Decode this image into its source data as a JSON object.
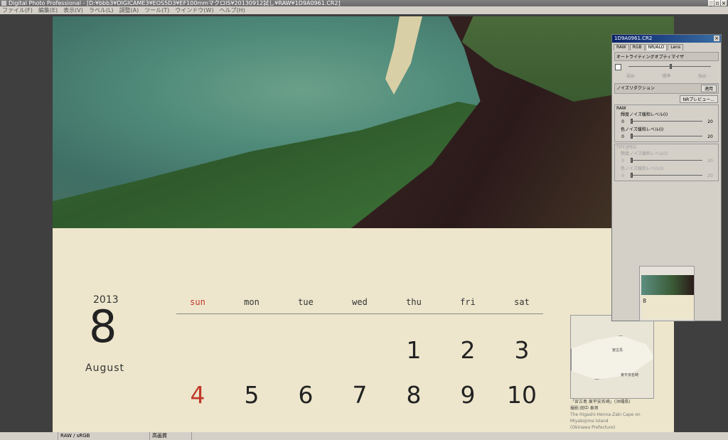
{
  "window": {
    "title": "Digital Photo Professional - [D:¥bbb3¥DIGICAME3¥EOS5D3¥EF100mmマクロIS¥20130912試し¥RAW¥1D9A0961.CR2]",
    "min": "_",
    "restore": "▫",
    "close": "×"
  },
  "menu": [
    "ファイル(F)",
    "編集(E)",
    "表示(V)",
    "ラベル(L)",
    "調整(A)",
    "ツール(T)",
    "ウインドウ(W)",
    "ヘルプ(H)"
  ],
  "calendar": {
    "year": "2013",
    "month_num": "8",
    "month_name": "August",
    "weekdays": [
      "sun",
      "mon",
      "tue",
      "wed",
      "thu",
      "fri",
      "sat"
    ],
    "row1": [
      "",
      "",
      "",
      "",
      "1",
      "2",
      "3"
    ],
    "row2": [
      "4",
      "5",
      "6",
      "7",
      "8",
      "9",
      "10"
    ],
    "caption_jp": "「宮古島 東平安名崎」(沖縄県)",
    "caption_credit": "撮影:田中 泰男",
    "caption_en1": "The Higashi-Henna-Zaki Cape on",
    "caption_en2": "Miyakojima Island",
    "caption_en3": "(Okinawa Prefecture)",
    "map_label1": "宮古島",
    "map_label2": "東平安名崎"
  },
  "nr_panel": {
    "title": "1D9A0961.CR2",
    "close": "×",
    "tabs": [
      "RAW",
      "RGB",
      "NR/ALO",
      "Lens"
    ],
    "alo_heading": "オートライティングオプティマイザ",
    "alo_levels": [
      "弱め",
      "標準",
      "強め"
    ],
    "nr_heading": "ノイズリダクション",
    "apply_btn": "適用",
    "nr_preview_btn": "NRプレビュー...",
    "raw_label": "RAW",
    "luma_label": "輝度ノイズ緩和レベル(I)",
    "chroma_label": "色ノイズ緩和レベル(I)",
    "tiff_label": "TIFF/JPEG",
    "tiff_luma_label": "輝度ノイズ緩和レベル(I)",
    "tiff_chroma_label": "色ノイズ緩和レベル(I)",
    "min": "0",
    "max": "20",
    "thumb_8": "8",
    "raw_luma_value": 0,
    "raw_chroma_value": 0
  },
  "status": {
    "mode": "RAW / sRGB",
    "quality": "高画質"
  }
}
